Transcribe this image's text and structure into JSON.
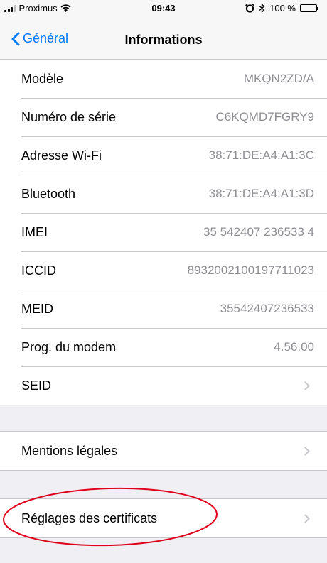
{
  "status_bar": {
    "carrier": "Proximus",
    "time": "09:43",
    "battery": "100 %",
    "battery_level": 1.0
  },
  "nav": {
    "back_label": "Général",
    "title": "Informations"
  },
  "info_rows": [
    {
      "label": "Modèle",
      "value": "MKQN2ZD/A"
    },
    {
      "label": "Numéro de série",
      "value": "C6KQMD7FGRY9"
    },
    {
      "label": "Adresse Wi-Fi",
      "value": "38:71:DE:A4:A1:3C"
    },
    {
      "label": "Bluetooth",
      "value": "38:71:DE:A4:A1:3D"
    },
    {
      "label": "IMEI",
      "value": "35 542407 236533 4"
    },
    {
      "label": "ICCID",
      "value": "8932002100197711023"
    },
    {
      "label": "MEID",
      "value": "35542407236533"
    },
    {
      "label": "Prog. du modem",
      "value": "4.56.00"
    },
    {
      "label": "SEID",
      "value": ""
    }
  ],
  "legal_row": {
    "label": "Mentions légales"
  },
  "certificates_row": {
    "label": "Réglages des certificats"
  },
  "colors": {
    "accent": "#007aff",
    "background": "#efeff4",
    "value_text": "#8e8e93",
    "annotation": "#e0001b"
  },
  "icons": [
    "signal-bars-icon",
    "wifi-icon",
    "alarm-icon",
    "bluetooth-icon",
    "battery-icon",
    "chevron-left-icon",
    "chevron-right-icon"
  ]
}
